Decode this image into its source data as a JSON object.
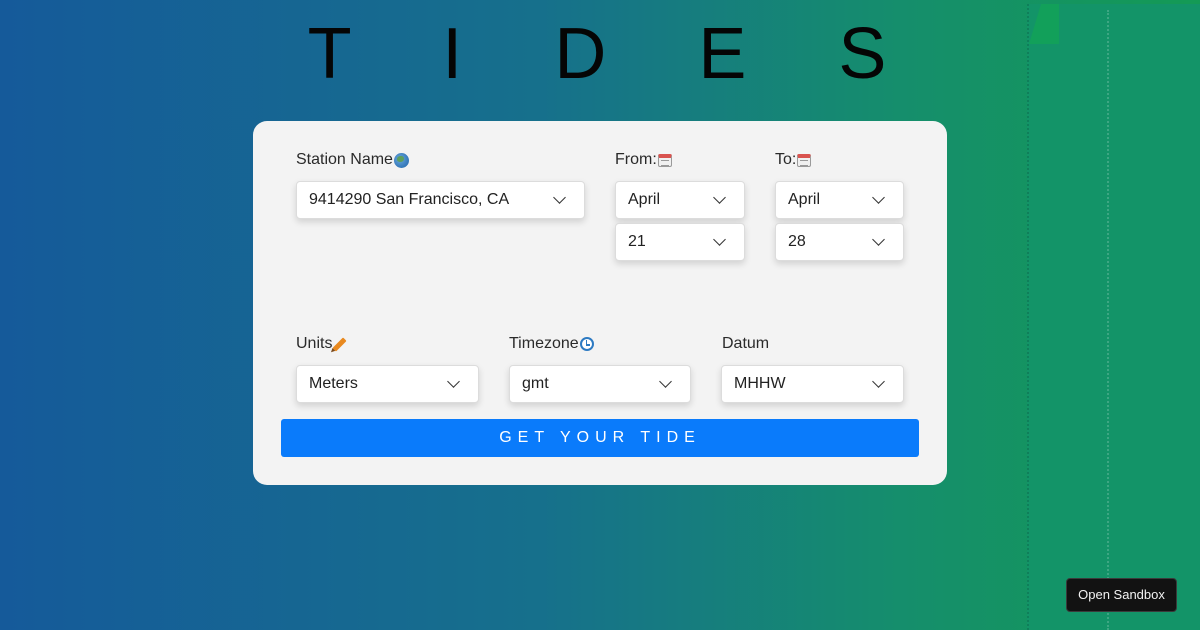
{
  "app": {
    "title": "T I D E S"
  },
  "form": {
    "station": {
      "label": "Station Name",
      "icon": "globe-icon",
      "selected": "9414290 San Francisco, CA"
    },
    "from": {
      "label": "From:",
      "icon": "calendar-icon",
      "month": "April",
      "day": "21"
    },
    "to": {
      "label": "To:",
      "icon": "calendar-icon",
      "month": "April",
      "day": "28"
    },
    "units": {
      "label": "Units",
      "icon": "pencil-icon",
      "selected": "Meters"
    },
    "timezone": {
      "label": "Timezone",
      "icon": "clock-icon",
      "selected": "gmt"
    },
    "datum": {
      "label": "Datum",
      "selected": "MHHW"
    },
    "submit_label": "GET YOUR TIDE"
  },
  "sandbox": {
    "label": "Open Sandbox"
  },
  "colors": {
    "accent": "#0a7bfb",
    "card_background": "#f3f3f3",
    "gradient_start": "#155a9a",
    "gradient_end": "#149a55"
  }
}
